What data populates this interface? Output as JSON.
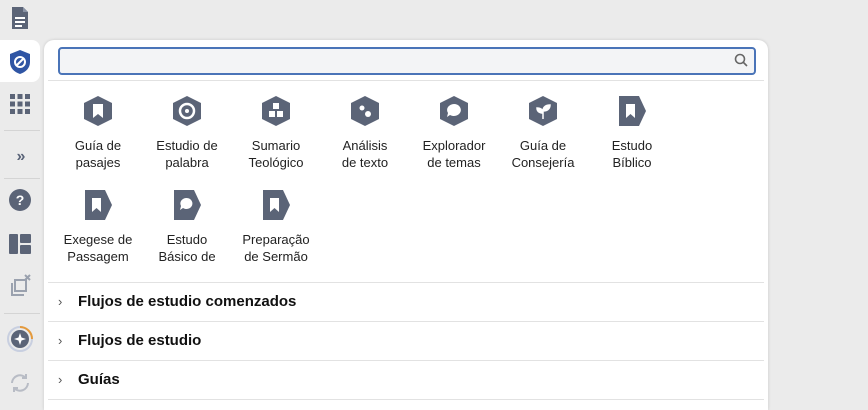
{
  "search": {
    "placeholder": "",
    "value": ""
  },
  "tools": [
    {
      "label": "Guía de\npasajes",
      "icon": "bookmark-hexagon-icon"
    },
    {
      "label": "Estudio de\npalabra",
      "icon": "word-study-icon"
    },
    {
      "label": "Sumario\nTeológico",
      "icon": "theology-grid-icon"
    },
    {
      "label": "Análisis\nde texto",
      "icon": "text-analysis-icon"
    },
    {
      "label": "Explorador\nde temas",
      "icon": "topic-bubble-icon"
    },
    {
      "label": "Guía de\nConsejería",
      "icon": "sprout-icon"
    },
    {
      "label": "Estudo\nBíblico",
      "icon": "bookmark-tag-icon"
    },
    {
      "label": "Exegese de\nPassagem",
      "icon": "bookmark-tag-icon"
    },
    {
      "label": "Estudo\nBásico de",
      "icon": "speech-tag-icon"
    },
    {
      "label": "Preparação\nde Sermão",
      "icon": "bookmark-tag-icon"
    }
  ],
  "sections": [
    {
      "title": "Flujos de estudio comenzados"
    },
    {
      "title": "Flujos de estudio"
    },
    {
      "title": "Guías"
    }
  ],
  "sidebar": {
    "collapse_label": "»"
  },
  "colors": {
    "icon": "#5b6477",
    "accent": "#2f55a4",
    "search_border": "#4a74b8"
  }
}
